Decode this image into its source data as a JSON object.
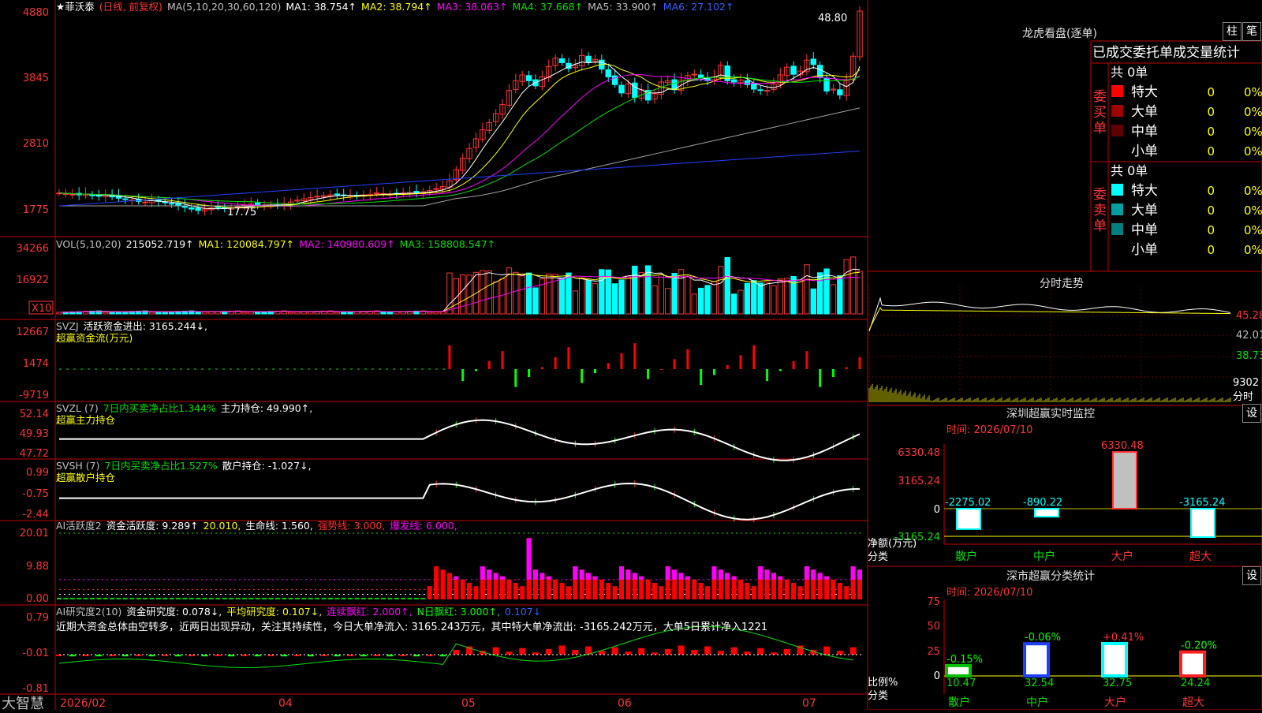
{
  "colors": {
    "up": "#ff3232",
    "down": "#00ffff",
    "frame": "#c00000",
    "white": "#ffffff",
    "yellow": "#ffff00",
    "magenta": "#ff00ff",
    "green": "#00e000",
    "gray": "#a0a0a0",
    "blue": "#0000ff"
  },
  "app": {
    "brand": "大智慧",
    "star_icon": "star-icon"
  },
  "price_panel": {
    "stock_name": "菲沃泰",
    "period_note": "(日线, 前复权)",
    "ma_label": "MA(5,10,20,30,60,120)",
    "ma1": "MA1: 38.754↑",
    "ma2": "MA2: 38.794↑",
    "ma3": "MA3: 38.063↑",
    "ma4": "MA4: 37.668↑",
    "ma5": "MA5: 33.900↑",
    "ma6": "MA6: 27.102↑",
    "axis": [
      "4880",
      "3845",
      "2810",
      "1775"
    ],
    "high_label": "48.80",
    "low_label": "17.75"
  },
  "vol_panel": {
    "label": "VOL(5,10,20)",
    "value": "215052.719↑",
    "ma1": "MA1: 120084.797↑",
    "ma2": "MA2: 140980.609↑",
    "ma3": "MA3: 158808.547↑",
    "axis": [
      "34266",
      "16922"
    ],
    "unit": "X10"
  },
  "svzj_panel": {
    "label": "SVZJ",
    "line1": "活跃资金进出: 3165.244↓,",
    "line2": "超赢资金流(万元)",
    "axis": [
      "12667",
      "1474",
      "-9719"
    ]
  },
  "svzl_panel": {
    "label": "SVZL (7)",
    "ratio": "7日内买卖净占比1.344%",
    "hold": "主力持仓: 49.990↑,",
    "line2": "超赢主力持仓",
    "axis": [
      "52.14",
      "49.93",
      "47.72"
    ]
  },
  "svsh_panel": {
    "label": "SVSH (7)",
    "ratio": "7日内买卖净占比1.527%",
    "hold": "散户持仓: -1.027↓,",
    "line2": "超赢散户持仓",
    "axis": [
      "0.99",
      "-0.75",
      "-2.44"
    ]
  },
  "ai_active_panel": {
    "label": "AI活跃度2",
    "active": "资金活跃度: 9.289↑",
    "v2": "20.010,",
    "life": "生命线: 1.560,",
    "strong": "强势线: 3.000,",
    "burst": "爆发线: 6.000,",
    "axis": [
      "20.01",
      "9.88",
      "0.00"
    ]
  },
  "ai_research_panel": {
    "label": "AI研究度2(10)",
    "research": "资金研究度: 0.078↓,",
    "avg": "平均研究度: 0.107↓,",
    "lianxu": "连续飘红: 2.000↑,",
    "nday": "N日飘红: 3.000↑,",
    "last": "0.107↓",
    "comment": "近期大资金总体由空转多，近两日出现异动，关注其持续性，今日大单净流入: 3165.243万元，其中特大单净流出: -3165.242万元，大单5日累计净入1221",
    "axis": [
      "0.79",
      "-0.01",
      "-0.81"
    ]
  },
  "x_axis": [
    "2026/02",
    "04",
    "05",
    "06",
    "07"
  ],
  "longhu": {
    "title": "龙虎看盘(逐单)",
    "btn1": "柱",
    "btn2": "笔",
    "header": "已成交委托单成交量统计",
    "buy_group": "委买单",
    "sell_group": "委卖单",
    "buy_total": "共 0单",
    "sell_total": "共 0单",
    "buy_rows": [
      {
        "name": "特大",
        "count": "0",
        "pct": "0%",
        "color": "#ff0000"
      },
      {
        "name": "大单",
        "count": "0",
        "pct": "0%",
        "color": "#a00000"
      },
      {
        "name": "中单",
        "count": "0",
        "pct": "0%",
        "color": "#600000"
      },
      {
        "name": "小单",
        "count": "0",
        "pct": "0%",
        "color": ""
      }
    ],
    "sell_rows": [
      {
        "name": "特大",
        "count": "0",
        "pct": "0%",
        "color": "#00ffff"
      },
      {
        "name": "大单",
        "count": "0",
        "pct": "0%",
        "color": "#00a0a0"
      },
      {
        "name": "中单",
        "count": "0",
        "pct": "0%",
        "color": "#008080"
      },
      {
        "name": "小单",
        "count": "0",
        "pct": "0%",
        "color": ""
      }
    ]
  },
  "intraday": {
    "title": "分时走势",
    "price_axis": [
      "45.28",
      "42.01",
      "38.73"
    ],
    "vol_axis": [
      "9302",
      "分时"
    ]
  },
  "sz_monitor": {
    "title": "深圳超赢实时监控",
    "settings": "设",
    "time": "时间: 2026/07/10",
    "axis": [
      "6330.48",
      "3165.24",
      "0",
      "-3165.24"
    ],
    "ylabel": "净额(万元)",
    "xlabel": "分类",
    "categories": [
      "散户",
      "中户",
      "大户",
      "超大"
    ],
    "value_labels": [
      "-2275.02",
      "-890.22",
      "6330.48",
      "-3165.24"
    ]
  },
  "sz_class": {
    "title": "深市超赢分类统计",
    "settings": "设",
    "time": "时间: 2026/07/10",
    "axis": [
      "75",
      "50",
      "25",
      "0"
    ],
    "ylabel": "比例%",
    "xlabel": "分类",
    "categories": [
      "散户",
      "中户",
      "大户",
      "超大"
    ],
    "change_labels": [
      "-0.15%",
      "-0.06%",
      "+0.41%",
      "-0.20%"
    ],
    "values_labels": [
      "10.47",
      "32.54",
      "32.75",
      "24.24"
    ]
  },
  "chart_data": [
    {
      "type": "candlestick",
      "title": "菲沃泰(日线, 前复权)",
      "x_ticks": [
        "2026/02",
        "04",
        "05",
        "06",
        "07"
      ],
      "ylim": [
        17.75,
        48.8
      ],
      "price_range_note_high": 48.8,
      "low": 17.75,
      "closes": [
        20.6,
        20.5,
        20.4,
        20.3,
        20.4,
        20.2,
        20.1,
        20.3,
        20.0,
        19.8,
        19.6,
        19.5,
        19.3,
        19.2,
        19.4,
        19.3,
        19.1,
        18.9,
        18.6,
        18.4,
        18.1,
        17.9,
        18.1,
        18.3,
        18.4,
        18.2,
        18.3,
        18.5,
        18.7,
        18.9,
        18.8,
        18.7,
        18.6,
        18.7,
        18.9,
        19.2,
        19.5,
        19.7,
        19.9,
        20.1,
        20.2,
        20.3,
        20.4,
        20.2,
        20.1,
        20.2,
        20.3,
        20.4,
        20.6,
        20.5,
        20.4,
        20.5,
        20.6,
        20.7,
        20.6,
        20.8,
        21.0,
        21.3,
        21.6,
        22.5,
        24.2,
        26.0,
        27.5,
        29.0,
        30.4,
        31.5,
        32.9,
        34.3,
        36.5,
        38.0,
        38.9,
        38.0,
        37.2,
        38.6,
        40.2,
        41.5,
        40.8,
        39.9,
        40.4,
        41.9,
        40.9,
        41.3,
        39.8,
        38.6,
        37.4,
        36.1,
        37.5,
        35.4,
        36.6,
        35.0,
        36.0,
        37.8,
        38.0,
        36.6,
        38.1,
        38.8,
        39.0,
        38.5,
        38.0,
        38.6,
        40.4,
        38.0,
        37.8,
        38.1,
        37.4,
        36.7,
        36.5,
        36.5,
        37.5,
        38.9,
        40.1,
        39.0,
        39.5,
        41.2,
        40.5,
        38.5,
        36.4,
        36.7,
        35.8,
        38.0,
        41.8,
        48.8
      ],
      "ma_values": {
        "MA1": 38.754,
        "MA2": 38.794,
        "MA3": 38.063,
        "MA4": 37.668,
        "MA5": 33.9,
        "MA6": 27.102
      }
    },
    {
      "type": "bar",
      "title": "VOL(5,10,20)",
      "ylim": [
        0,
        34266
      ],
      "last_value": 215052.719,
      "ma_values": {
        "MA1": 120084.797,
        "MA2": 140980.609,
        "MA3": 158808.547
      }
    },
    {
      "type": "bar",
      "title": "超赢资金流(万元)",
      "ylim": [
        -9719,
        12667
      ],
      "last_value": 3165.244
    },
    {
      "type": "line",
      "title": "超赢主力持仓",
      "ylim": [
        47.72,
        52.14
      ],
      "last_value": 49.99
    },
    {
      "type": "line",
      "title": "超赢散户持仓",
      "ylim": [
        -2.44,
        0.99
      ],
      "last_value": -1.027
    },
    {
      "type": "bar",
      "title": "AI活跃度2",
      "ylim": [
        0,
        20.01
      ],
      "last_value": 9.289,
      "reference_lines": {
        "生命线": 1.56,
        "强势线": 3.0,
        "爆发线": 6.0
      }
    },
    {
      "type": "bar",
      "title": "AI研究度2(10)",
      "ylim": [
        -0.81,
        0.79
      ],
      "last_value": 0.078
    },
    {
      "type": "bar",
      "title": "深圳超赢实时监控",
      "categories": [
        "散户",
        "中户",
        "大户",
        "超大"
      ],
      "values": [
        -2275.02,
        -890.22,
        6330.48,
        -3165.24
      ],
      "ylim": [
        -3165.24,
        6330.48
      ],
      "ylabel": "净额(万元)",
      "xlabel": "分类"
    },
    {
      "type": "bar",
      "title": "深市超赢分类统计",
      "categories": [
        "散户",
        "中户",
        "大户",
        "超大"
      ],
      "values": [
        10.47,
        32.54,
        32.75,
        24.24
      ],
      "changes": [
        "-0.15%",
        "-0.06%",
        "+0.41%",
        "-0.20%"
      ],
      "ylim": [
        0,
        75
      ],
      "ylabel": "比例%",
      "xlabel": "分类"
    },
    {
      "type": "line",
      "title": "分时走势",
      "ylim": [
        38.73,
        45.28
      ]
    }
  ]
}
